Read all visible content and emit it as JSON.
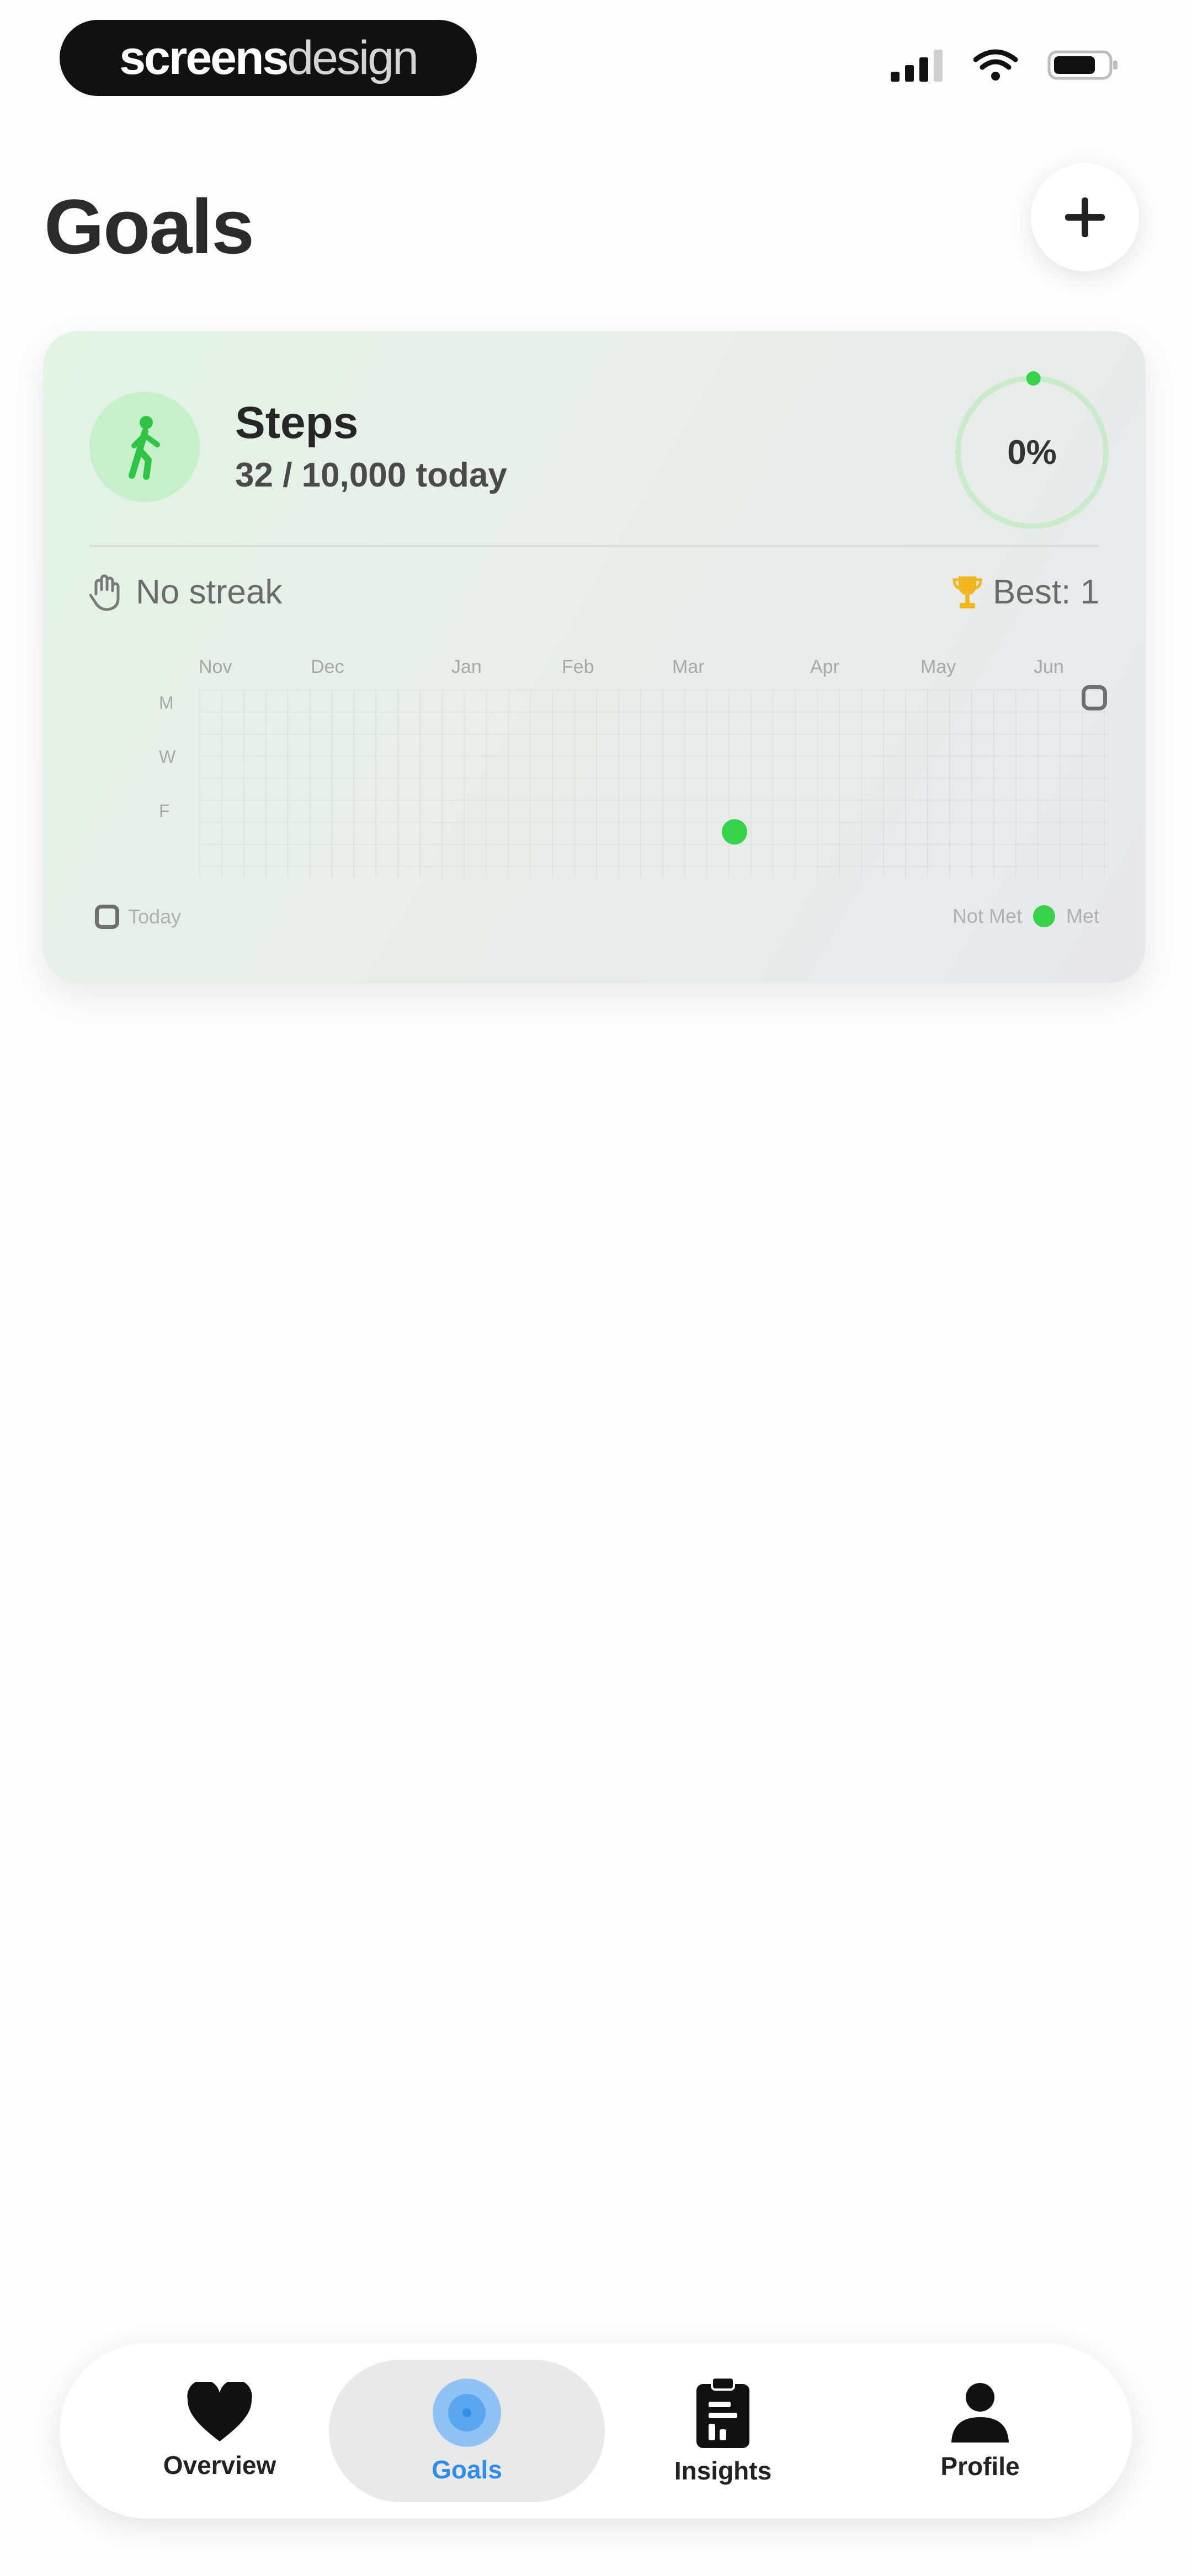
{
  "status_bar": {
    "brand_part1": "screens",
    "brand_part2": "design",
    "icons": [
      "signal-icon",
      "wifi-icon",
      "battery-icon"
    ]
  },
  "header": {
    "title": "Goals",
    "add_icon": "plus-icon"
  },
  "goal_card": {
    "icon": "walking-icon",
    "name": "Steps",
    "progress_text": "32 / 10,000 today",
    "progress_percent": "0%",
    "progress_fraction": 0.0032,
    "streak_icon": "hand-icon",
    "streak_text": "No streak",
    "best_icon": "trophy-icon",
    "best_text": "Best: 1",
    "heatmap": {
      "months": [
        "Nov",
        "Dec",
        "Jan",
        "Feb",
        "Mar",
        "Apr",
        "May",
        "Jun"
      ],
      "days": [
        "M",
        "W",
        "F"
      ],
      "legend_today": "Today",
      "legend_not_met": "Not Met",
      "legend_met": "Met"
    }
  },
  "colors": {
    "accent_green": "#35d24a",
    "active_tab": "#2f8ee8"
  },
  "bottom_nav": {
    "items": [
      {
        "label": "Overview",
        "icon": "heart-icon",
        "active": false
      },
      {
        "label": "Goals",
        "icon": "target-icon",
        "active": true
      },
      {
        "label": "Insights",
        "icon": "clipboard-icon",
        "active": false
      },
      {
        "label": "Profile",
        "icon": "person-icon",
        "active": false
      }
    ]
  }
}
